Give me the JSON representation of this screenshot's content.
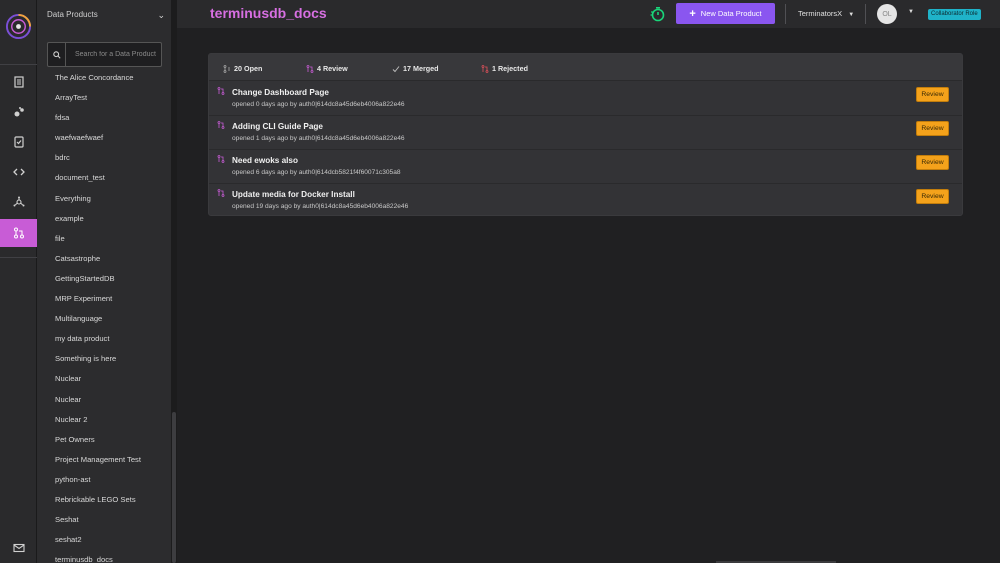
{
  "header": {
    "title": "terminusdb_docs",
    "new_button_label": "New Data Product",
    "team": "TerminatorsX",
    "avatar_initials": "OL",
    "role_badge": "Collaborator Role"
  },
  "sidebar": {
    "heading": "Data Products",
    "search_placeholder": "Search for a Data Product",
    "items": [
      "The Alice Concordance",
      "ArrayTest",
      "fdsa",
      "waefwaefwaef",
      "bdrc",
      "document_test",
      "Everything",
      "example",
      "file",
      "Catsastrophe",
      "GettingStartedDB",
      "MRP Experiment",
      "Multilanguage",
      "my data product",
      "Something is here",
      "Nuclear",
      "Nuclear",
      "Nuclear 2",
      "Pet Owners",
      "Project Management Test",
      "python-ast",
      "Rebrickable LEGO Sets",
      "Seshat",
      "seshat2",
      "terminusdb_docs"
    ]
  },
  "rail": {
    "icons": [
      "document-icon",
      "graph-icon",
      "check-document-icon",
      "code-icon",
      "network-icon",
      "change-request-icon"
    ],
    "bottom_icon": "mail-icon"
  },
  "stats": {
    "open": "20 Open",
    "review": "4 Review",
    "merged": "17 Merged",
    "rejected": "1 Rejected"
  },
  "requests": [
    {
      "title": "Change Dashboard Page",
      "meta": "opened 0 days ago by auth0|614dc8a45d6eb4006a822e46",
      "action": "Review"
    },
    {
      "title": "Adding CLI Guide Page",
      "meta": "opened 1 days ago by auth0|614dc8a45d6eb4006a822e46",
      "action": "Review"
    },
    {
      "title": "Need ewoks also",
      "meta": "opened 6 days ago by auth0|614dcb5821f4f60071c305a8",
      "action": "Review"
    },
    {
      "title": "Update media for Docker Install",
      "meta": "opened 19 days ago by auth0|614dc8a45d6eb4006a822e46",
      "action": "Review"
    }
  ],
  "colors": {
    "accent": "#d76fe2",
    "primary_button": "#8a56f0",
    "review_button": "#f4a21b",
    "active_rail": "#c85cd6",
    "timer": "#19d67a",
    "badge": "#1fb3c9"
  }
}
